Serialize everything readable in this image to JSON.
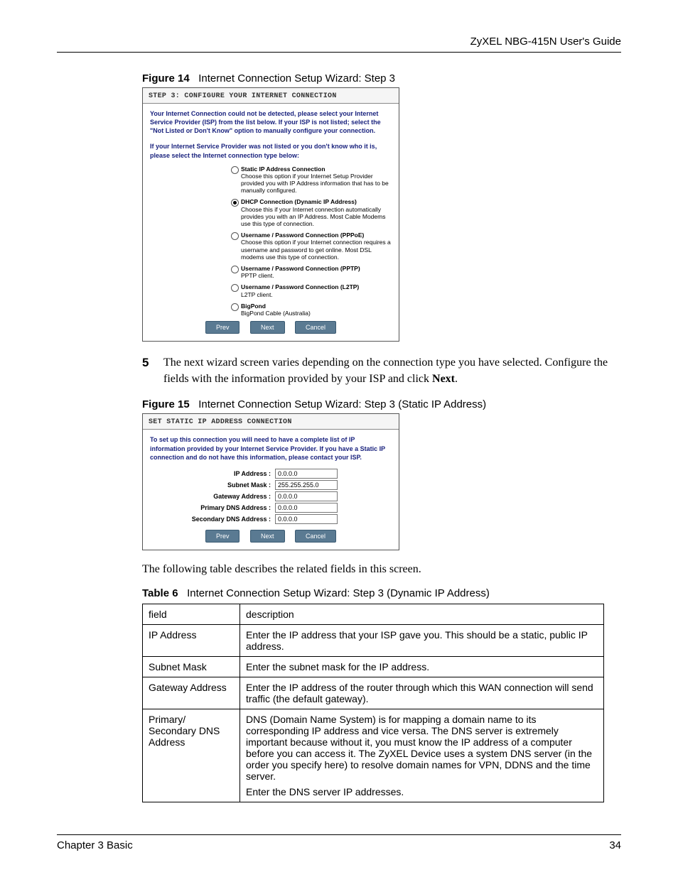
{
  "header": {
    "doc_title": "ZyXEL NBG-415N User's Guide"
  },
  "figure14": {
    "label": "Figure 14",
    "caption": "Internet Connection Setup Wizard: Step 3",
    "panel_title": "STEP 3: CONFIGURE YOUR INTERNET CONNECTION",
    "intro1": "Your Internet Connection could not be detected, please select your Internet Service Provider (ISP) from the list below. If your ISP is not listed; select the \"Not Listed or Don't Know\" option to manually configure your connection.",
    "intro2": "If your Internet Service Provider was not listed or you don't know who it is, please select the Internet connection type below:",
    "options": [
      {
        "title": "Static IP Address Connection",
        "desc": "Choose this option if your Internet Setup Provider provided you with IP Address information that has to be manually configured.",
        "checked": false
      },
      {
        "title": "DHCP Connection (Dynamic IP Address)",
        "desc": "Choose this if your Internet connection automatically provides you with an IP Address. Most Cable Modems use this type of connection.",
        "checked": true
      },
      {
        "title": "Username / Password Connection (PPPoE)",
        "desc": "Choose this option if your Internet connection requires a username and password to get online. Most DSL modems use this type of connection.",
        "checked": false
      },
      {
        "title": "Username / Password Connection (PPTP)",
        "desc": "PPTP client.",
        "checked": false
      },
      {
        "title": "Username / Password Connection (L2TP)",
        "desc": "L2TP client.",
        "checked": false
      },
      {
        "title": "BigPond",
        "desc": "BigPond Cable (Australia)",
        "checked": false
      }
    ],
    "buttons": {
      "prev": "Prev",
      "next": "Next",
      "cancel": "Cancel"
    }
  },
  "step5": {
    "number": "5",
    "text_before": "The next wizard screen varies depending on the connection type you have selected. Configure the fields with the information provided by your ISP and click ",
    "bold": "Next",
    "text_after": "."
  },
  "figure15": {
    "label": "Figure 15",
    "caption": "Internet Connection Setup Wizard: Step 3 (Static IP Address)",
    "panel_title": "SET STATIC IP ADDRESS CONNECTION",
    "intro": "To set up this connection you will need to have a complete list of IP information provided by your Internet Service Provider. If you have a Static IP connection and do not have this information, please contact your ISP.",
    "fields": [
      {
        "label": "IP Address :",
        "value": "0.0.0.0"
      },
      {
        "label": "Subnet Mask :",
        "value": "255.255.255.0"
      },
      {
        "label": "Gateway Address :",
        "value": "0.0.0.0"
      },
      {
        "label": "Primary DNS Address :",
        "value": "0.0.0.0"
      },
      {
        "label": "Secondary DNS Address :",
        "value": "0.0.0.0"
      }
    ],
    "buttons": {
      "prev": "Prev",
      "next": "Next",
      "cancel": "Cancel"
    }
  },
  "para": "The following table describes the related fields in this screen.",
  "table6": {
    "label": "Table 6",
    "caption": "Internet Connection Setup Wizard: Step 3 (Dynamic IP Address)",
    "headers": {
      "field": "field",
      "description": "description"
    },
    "rows": [
      {
        "field": "IP Address",
        "desc": "Enter the IP address that your ISP gave you. This should be a static, public IP address."
      },
      {
        "field": "Subnet Mask",
        "desc": "Enter the subnet mask for the IP address."
      },
      {
        "field": "Gateway Address",
        "desc": "Enter the IP address of the router through which this WAN connection will send traffic (the default gateway)."
      },
      {
        "field": "Primary/ Secondary DNS Address",
        "desc": "DNS (Domain Name System) is for mapping a domain name to its corresponding IP address and vice versa. The DNS server is extremely important because without it, you must know the IP address of a computer before you can access it. The ZyXEL Device uses a system DNS server (in the order you specify here) to resolve domain names for VPN, DDNS and the time server.",
        "desc2": "Enter the DNS server IP addresses."
      }
    ]
  },
  "footer": {
    "chapter": "Chapter 3 Basic",
    "page": "34"
  }
}
